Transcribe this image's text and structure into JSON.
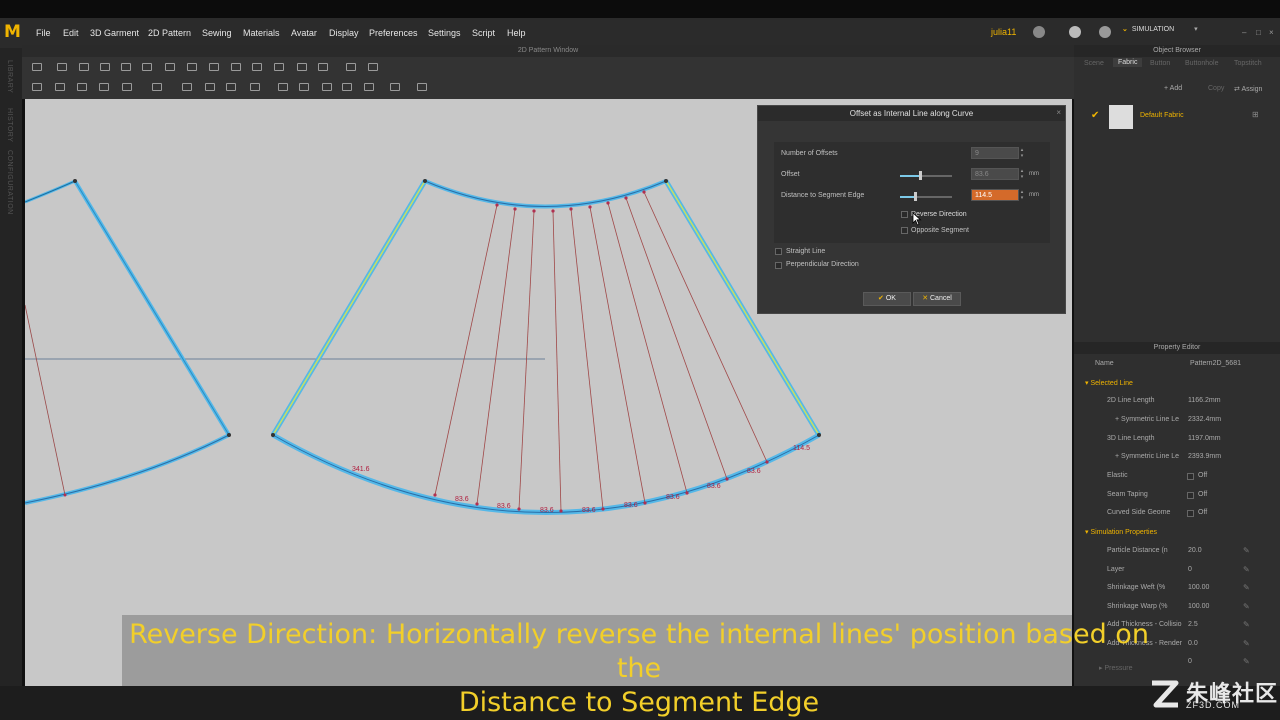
{
  "menubar": {
    "items": [
      "File",
      "Edit",
      "3D Garment",
      "2D Pattern",
      "Sewing",
      "Materials",
      "Avatar",
      "Display",
      "Preferences",
      "Settings",
      "Script",
      "Help"
    ],
    "user": "julia11",
    "mode": "SIMULATION",
    "logo": "M"
  },
  "left_strip": [
    "LIBRARY",
    "HISTORY",
    "CONFIGURATION"
  ],
  "pattern_window": {
    "title": "2D Pattern Window",
    "measure_labels": [
      "341.6",
      "83.6",
      "83.6",
      "83.6",
      "83.6",
      "83.6",
      "83.6",
      "83.6",
      "83.6",
      "114.5"
    ]
  },
  "dialog": {
    "title": "Offset as Internal Line along Curve",
    "number_of_offsets_label": "Number of Offsets",
    "number_of_offsets_value": "9",
    "offset_label": "Offset",
    "offset_value": "83.6",
    "offset_unit": "mm",
    "distance_label": "Distance to Segment Edge",
    "distance_value": "114.5",
    "distance_unit": "mm",
    "reverse_direction": "Reverse Direction",
    "opposite_segment": "Opposite Segment",
    "straight_line": "Straight Line",
    "perpendicular_direction": "Perpendicular Direction",
    "ok": "OK",
    "cancel": "Cancel"
  },
  "object_browser": {
    "title": "Object Browser",
    "tabs": [
      "Scene",
      "Fabric",
      "Button",
      "Buttonhole",
      "Topstitch"
    ],
    "active_tab": "Fabric",
    "add": "Add",
    "copy": "Copy",
    "assign": "Assign",
    "fabric_name": "Default Fabric"
  },
  "property_editor": {
    "title": "Property Editor",
    "name_label": "Name",
    "name_value": "Pattern2D_5681",
    "selected_line": "Selected Line",
    "rows": [
      {
        "label": "2D Line Length",
        "value": "1166.2mm"
      },
      {
        "label": "+ Symmetric Line Le",
        "value": "2332.4mm"
      },
      {
        "label": "3D Line Length",
        "value": "1197.0mm"
      },
      {
        "label": "+ Symmetric Line Le",
        "value": "2393.9mm"
      },
      {
        "label": "Elastic",
        "value": "Off"
      },
      {
        "label": "Seam Taping",
        "value": "Off"
      },
      {
        "label": "Curved Side Geome",
        "value": "Off"
      }
    ],
    "simulation_properties": "Simulation Properties",
    "sim_rows": [
      {
        "label": "Particle Distance (n",
        "value": "20.0"
      },
      {
        "label": "Layer",
        "value": "0"
      },
      {
        "label": "Shrinkage Weft (%",
        "value": "100.00"
      },
      {
        "label": "Shrinkage Warp (%",
        "value": "100.00"
      },
      {
        "label": "Add Thickness - Collisio",
        "value": "2.5"
      },
      {
        "label": "Add Thickness - Render",
        "value": "0.0"
      },
      {
        "label": "",
        "value": "0"
      }
    ],
    "pressure": "Pressure"
  },
  "subtitle": {
    "line1": "Reverse Direction: Horizontally reverse the internal lines' position based on the",
    "line2": "Distance to Segment Edge"
  },
  "watermark": {
    "brand": "朱峰社区",
    "domain": "ZF3D.COM"
  }
}
